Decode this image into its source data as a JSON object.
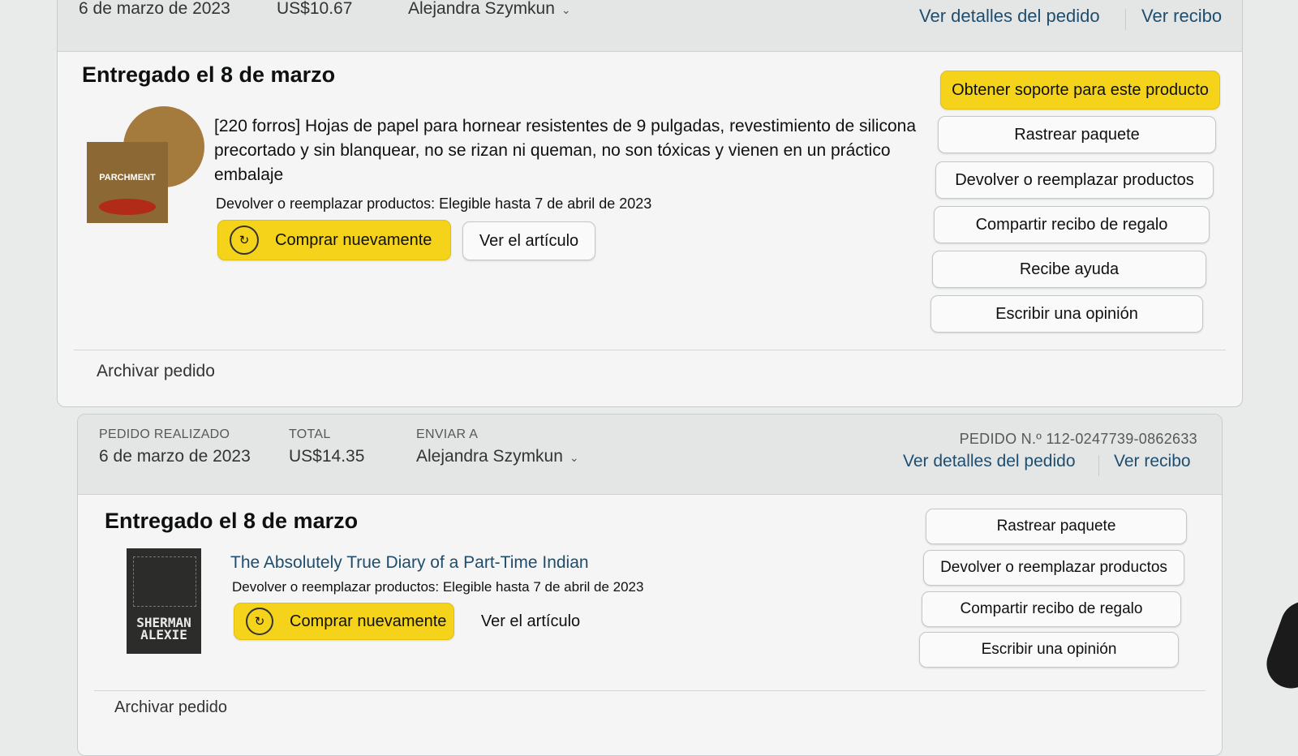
{
  "order1": {
    "header": {
      "date": "6 de marzo de 2023",
      "total": "US$10.67",
      "ship_to": "Alejandra Szymkun",
      "details_link": "Ver detalles del pedido",
      "receipt_link": "Ver recibo"
    },
    "delivered": "Entregado el 8 de marzo",
    "product": {
      "title": "[220 forros] Hojas de papel para hornear resistentes de 9 pulgadas, revestimiento de silicona precortado y sin blanquear, no se rizan ni queman, no son tóxicas y vienen en un práctico embalaje",
      "thumb_text": "PARCHMENT",
      "return_note": "Devolver o reemplazar productos: Elegible hasta 7 de abril de 2023",
      "buy_again": "Comprar nuevamente",
      "view_item": "Ver el artículo"
    },
    "actions": [
      "Obtener soporte para este producto",
      "Rastrear paquete",
      "Devolver o reemplazar productos",
      "Compartir recibo de regalo",
      "Recibe ayuda",
      "Escribir una opinión"
    ],
    "archive": "Archivar pedido"
  },
  "order2": {
    "header": {
      "placed_label": "PEDIDO REALIZADO",
      "placed_value": "6 de marzo de 2023",
      "total_label": "TOTAL",
      "total_value": "US$14.35",
      "ship_label": "ENVIAR A",
      "ship_value": "Alejandra Szymkun",
      "order_number": "PEDIDO N.º 112-0247739-0862633",
      "details_link": "Ver detalles del pedido",
      "receipt_link": "Ver recibo"
    },
    "delivered": "Entregado el 8 de marzo",
    "product": {
      "title": "The Absolutely True Diary of a Part-Time Indian",
      "thumb_author": "SHERMAN ALEXIE",
      "return_note": "Devolver o reemplazar productos: Elegible hasta 7 de abril de 2023",
      "buy_again": "Comprar nuevamente",
      "view_item": "Ver el artículo"
    },
    "actions": [
      "Rastrear paquete",
      "Devolver o reemplazar productos",
      "Compartir recibo de regalo",
      "Escribir una opinión"
    ],
    "archive": "Archivar pedido"
  },
  "colors": {
    "primary_button": "#f4d31a",
    "link": "#1f4d6e"
  }
}
